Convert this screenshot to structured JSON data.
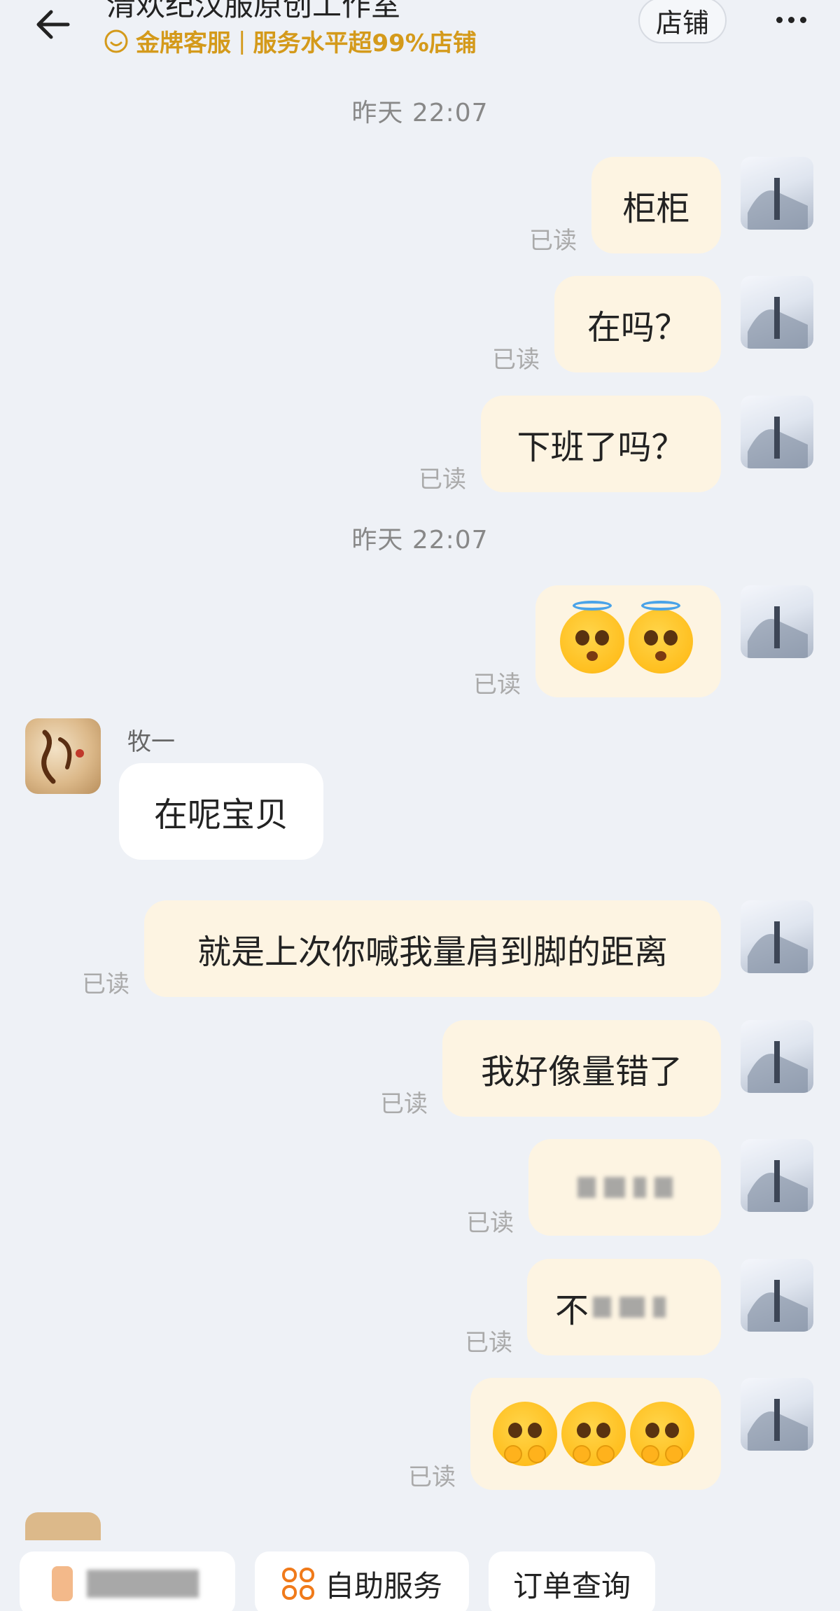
{
  "header": {
    "title": "清欢纪汉服原创工作室",
    "badge_gold": "金牌客服",
    "badge_sep": "|",
    "badge_service": "服务水平超99%店铺",
    "store_button": "店铺",
    "back_icon": "back-arrow-icon",
    "more_icon": "more-icon"
  },
  "messages": {
    "ts1": "昨天  22:07",
    "ts2": "昨天  22:07",
    "m1": {
      "text": "柜柜",
      "status": "已读"
    },
    "m2": {
      "text": "在吗？",
      "status": "已读"
    },
    "m3": {
      "text": "下班了吗？",
      "status": "已读"
    },
    "m4": {
      "status": "已读",
      "emoji": "halo-face-emoji"
    },
    "m5": {
      "sender": "牧一",
      "text": "在呢宝贝"
    },
    "m6": {
      "text": "就是上次你喊我量肩到脚的距离",
      "status": "已读"
    },
    "m7": {
      "text": "我好像量错了",
      "status": "已读"
    },
    "m8": {
      "status": "已读"
    },
    "m9": {
      "text_prefix": "不",
      "status": "已读"
    },
    "m10": {
      "status": "已读",
      "emoji": "pleading-face-emoji"
    }
  },
  "bottom_bar": {
    "chip2_label": "自助服务",
    "chip3_label": "订单查询",
    "chip2_icon": "grid-icon"
  },
  "colors": {
    "background": "#eef1f6",
    "bubble_self": "#fdf4e2",
    "bubble_other": "#ffffff",
    "badge_gold": "#d49a1b",
    "read_text": "#aaaaaa",
    "grid_icon": "#f07a1a"
  }
}
